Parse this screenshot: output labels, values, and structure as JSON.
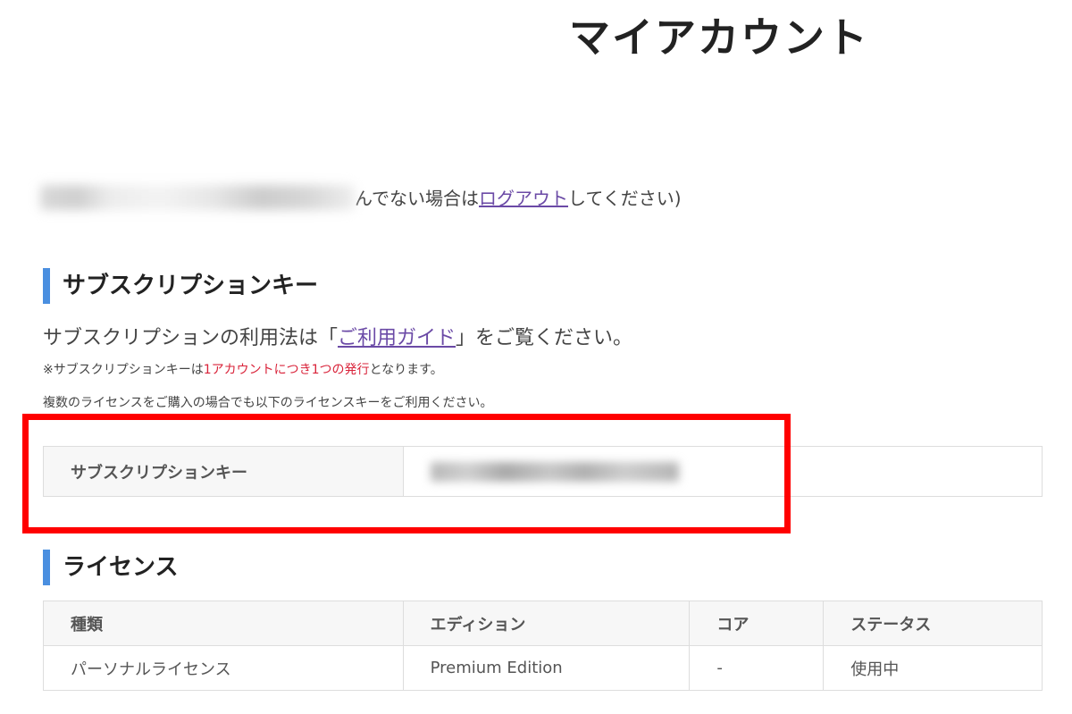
{
  "page": {
    "title": "マイアカウント"
  },
  "greeting": {
    "suffix_text": "んでない場合は",
    "logout_link": "ログアウト",
    "tail_text": "してください)"
  },
  "subscription": {
    "heading": "サブスクリプションキー",
    "guide_prefix": "サブスクリプションの利用法は「",
    "guide_link": "ご利用ガイド",
    "guide_suffix": "」をご覧ください。",
    "note1_prefix": "※サブスクリプションキーは",
    "note1_highlight": "1アカウントにつき1つの発行",
    "note1_suffix": "となります。",
    "note2": "複数のライセンスをご購入の場合でも以下のライセンスキーをご利用ください。",
    "key_label": "サブスクリプションキー",
    "highlight_color": "#ff0000"
  },
  "license": {
    "heading": "ライセンス",
    "columns": [
      "種類",
      "エディション",
      "コア",
      "ステータス"
    ],
    "rows": [
      [
        "パーソナルライセンス",
        "Premium Edition",
        "-",
        "使用中"
      ]
    ]
  },
  "colors": {
    "accent": "#4a8fe0",
    "link": "#6b4aa6",
    "emphasis_red": "#d9233a"
  }
}
